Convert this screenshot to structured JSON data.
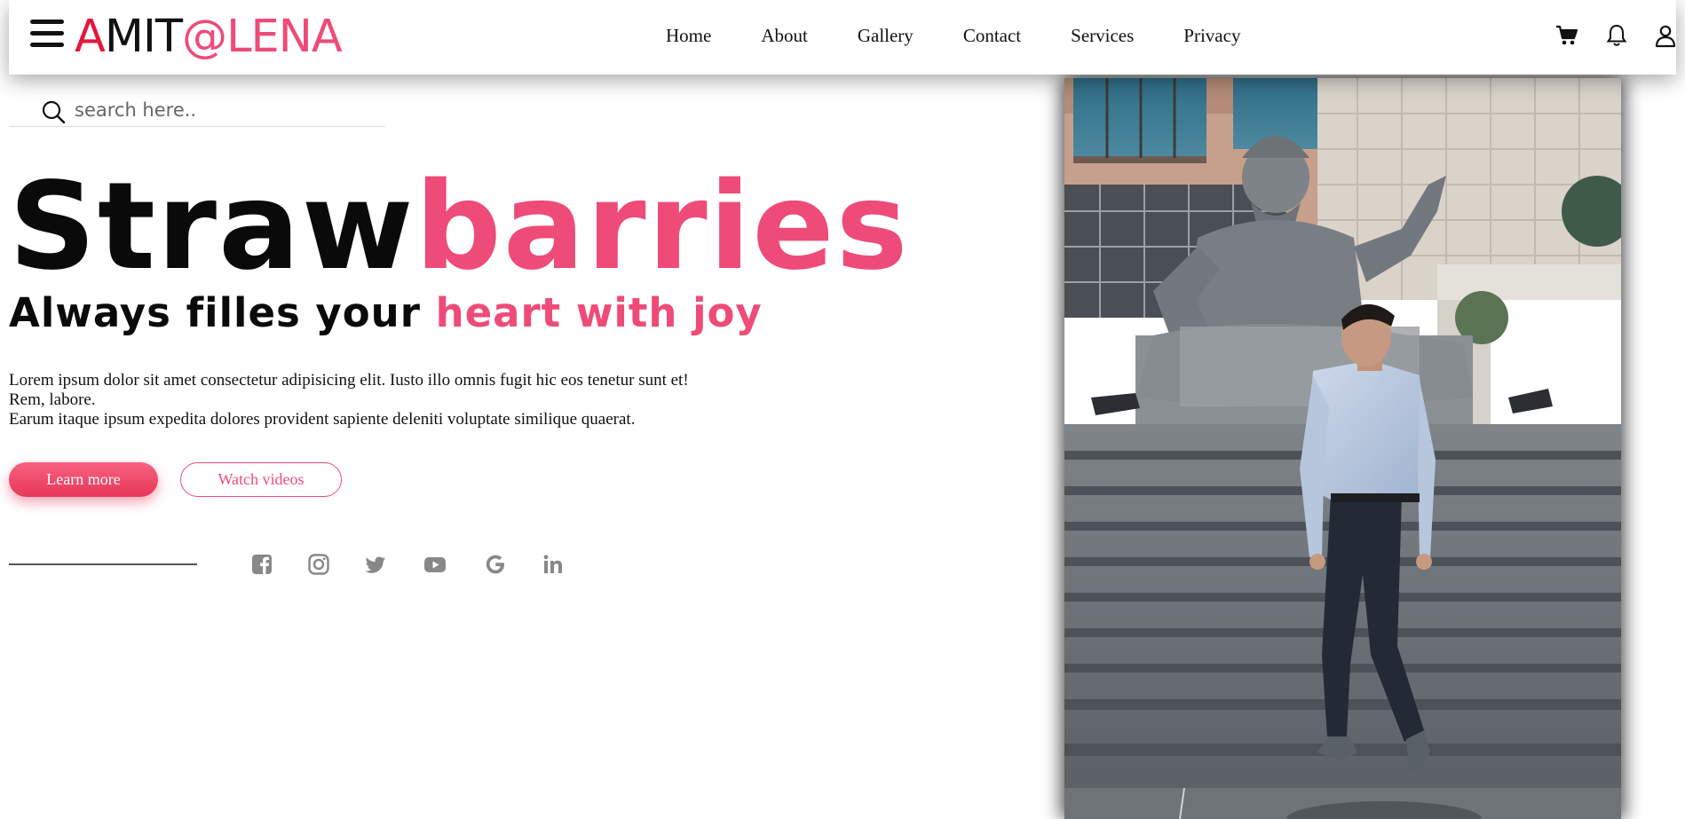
{
  "brand": {
    "part1": "A",
    "part2": "MIT",
    "part3": "@LENA"
  },
  "nav": {
    "links": [
      "Home",
      "About",
      "Gallery",
      "Contact",
      "Services",
      "Privacy"
    ]
  },
  "search": {
    "placeholder": "search here.."
  },
  "hero": {
    "title_part1": "Straw",
    "title_part2": "barries",
    "subtitle_part1": "Always filles your ",
    "subtitle_part2": "heart with joy",
    "paragraph_lines": [
      "Lorem ipsum dolor sit amet consectetur adipisicing elit. Iusto illo omnis fugit hic eos tenetur sunt et!",
      "Rem, labore.",
      "Earum itaque ipsum expedita dolores provident sapiente deleniti voluptate similique quaerat."
    ],
    "learn_more_label": "Learn more",
    "watch_videos_label": "Watch videos"
  },
  "social": [
    "facebook-icon",
    "instagram-icon",
    "twitter-icon",
    "youtube-icon",
    "google-icon",
    "linkedin-icon"
  ],
  "icons": [
    "menu-icon",
    "cart-icon",
    "bell-icon",
    "user-icon",
    "search-icon"
  ],
  "colors": {
    "accent": "#ef4b78",
    "brand_red": "#e3173d",
    "button_gradient_top": "#f7627f",
    "button_gradient_bottom": "#e8365a"
  }
}
